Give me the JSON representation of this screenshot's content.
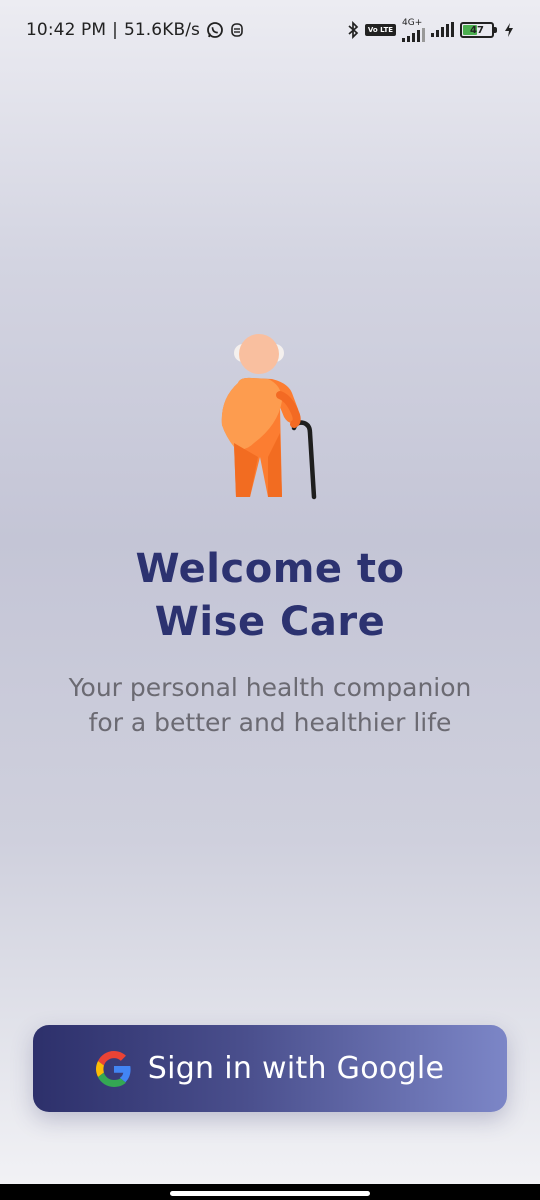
{
  "status_bar": {
    "time": "10:42 PM",
    "separator": "|",
    "speed": "51.6KB/s",
    "network_type": "4G+",
    "volte_label": "Vo LTE",
    "battery_level": "47",
    "icons": [
      "whatsapp-icon",
      "notification-icon",
      "bluetooth-icon",
      "volte-icon",
      "signal-icon",
      "signal-icon",
      "battery-icon",
      "charging-icon"
    ]
  },
  "welcome": {
    "title_line1": "Welcome to",
    "title_line2": "Wise Care",
    "subtitle_line1": "Your personal health companion",
    "subtitle_line2": "for a better and healthier life"
  },
  "illustration": {
    "icon": "elderly-person-icon",
    "color": "#fb7b31"
  },
  "sign_in": {
    "label": "Sign in with Google",
    "icon": "google-icon"
  },
  "colors": {
    "title": "#2c3270",
    "subtitle": "#6b6a72",
    "button_start": "#2d306b",
    "button_end": "#7c86c7",
    "battery_fill": "#4caf50"
  }
}
